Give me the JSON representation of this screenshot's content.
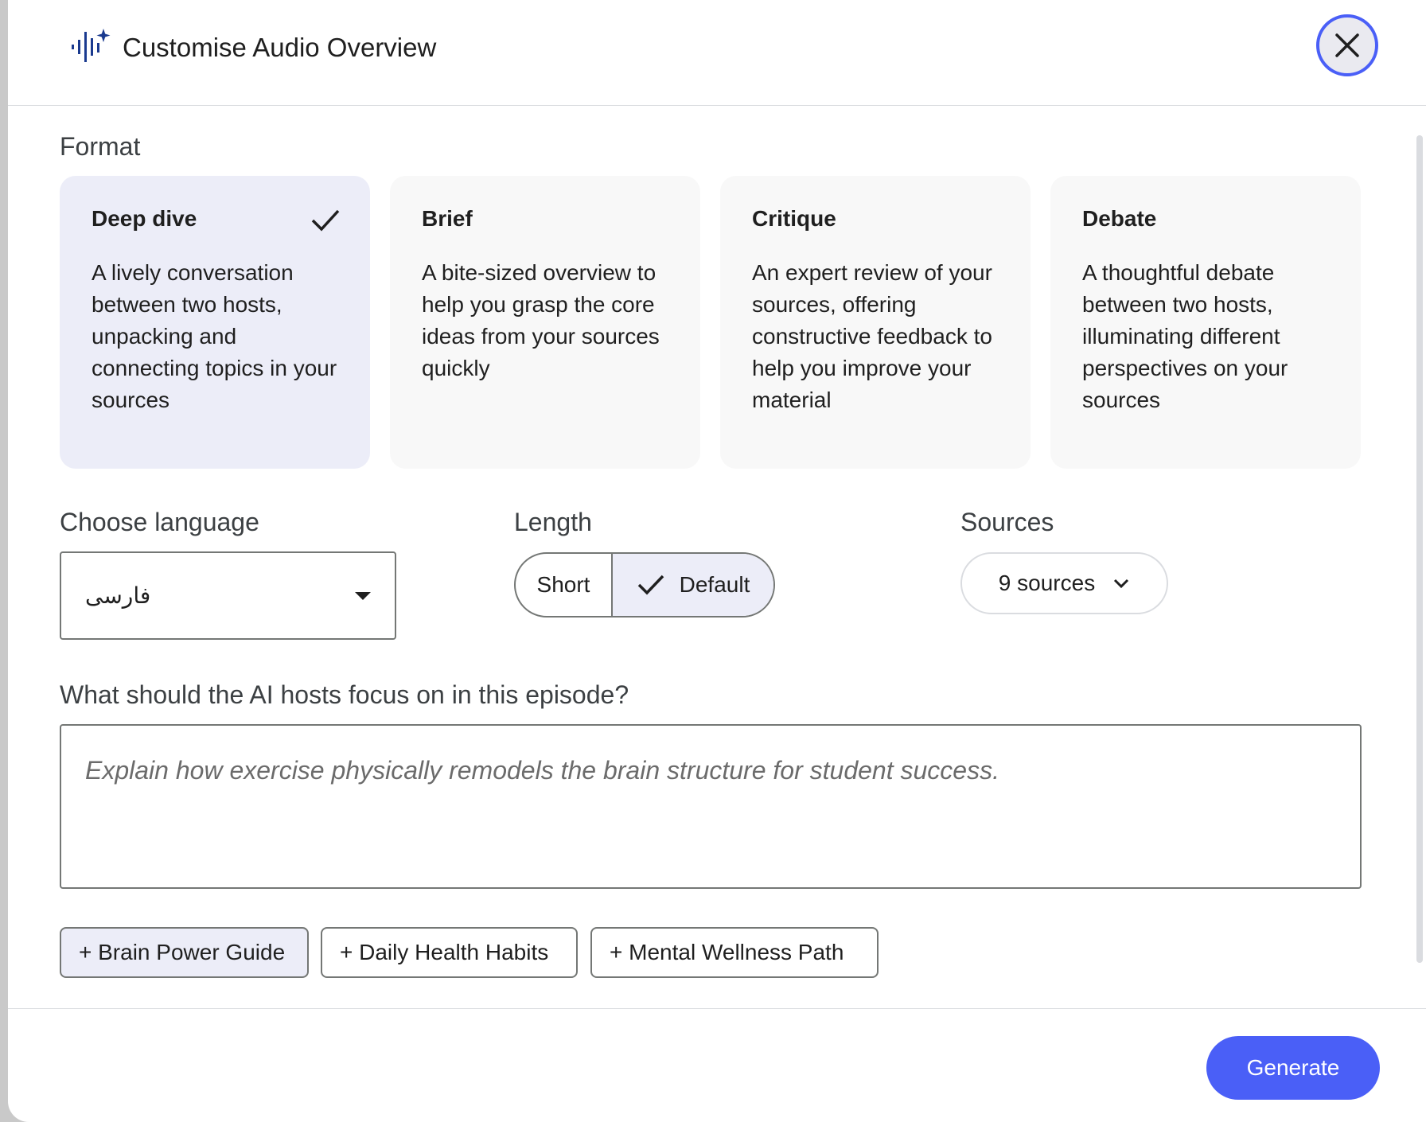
{
  "header": {
    "title": "Customise Audio Overview",
    "icon": "audio-waveform-sparkle-icon",
    "close_icon": "close-icon"
  },
  "format": {
    "label": "Format",
    "cards": [
      {
        "title": "Deep dive",
        "desc": "A lively conversation between two hosts, unpacking and connecting topics in your sources",
        "selected": true
      },
      {
        "title": "Brief",
        "desc": "A bite-sized overview to help you grasp the core ideas from your sources quickly",
        "selected": false
      },
      {
        "title": "Critique",
        "desc": "An expert review of your sources, offering constructive feedback to help you improve your material",
        "selected": false
      },
      {
        "title": "Debate",
        "desc": "A thoughtful debate between two hosts, illuminating different perspectives on your sources",
        "selected": false
      }
    ]
  },
  "language": {
    "label": "Choose language",
    "value": "فارسی"
  },
  "length": {
    "label": "Length",
    "options": [
      "Short",
      "Default"
    ],
    "selected": "Default"
  },
  "sources": {
    "label": "Sources",
    "value": "9 sources"
  },
  "focus": {
    "label": "What should the AI hosts focus on in this episode?",
    "placeholder": "Explain how exercise physically remodels the brain structure for student success.",
    "value": ""
  },
  "chips": [
    {
      "label": "+ Brain Power Guide",
      "active": true
    },
    {
      "label": "+ Daily Health Habits",
      "active": false
    },
    {
      "label": "+ Mental Wellness Path",
      "active": false
    }
  ],
  "footer": {
    "generate_label": "Generate"
  },
  "colors": {
    "accent": "#4a5ff7",
    "selected_bg": "#ecedf8",
    "icon_blue": "#1a3a8f"
  }
}
